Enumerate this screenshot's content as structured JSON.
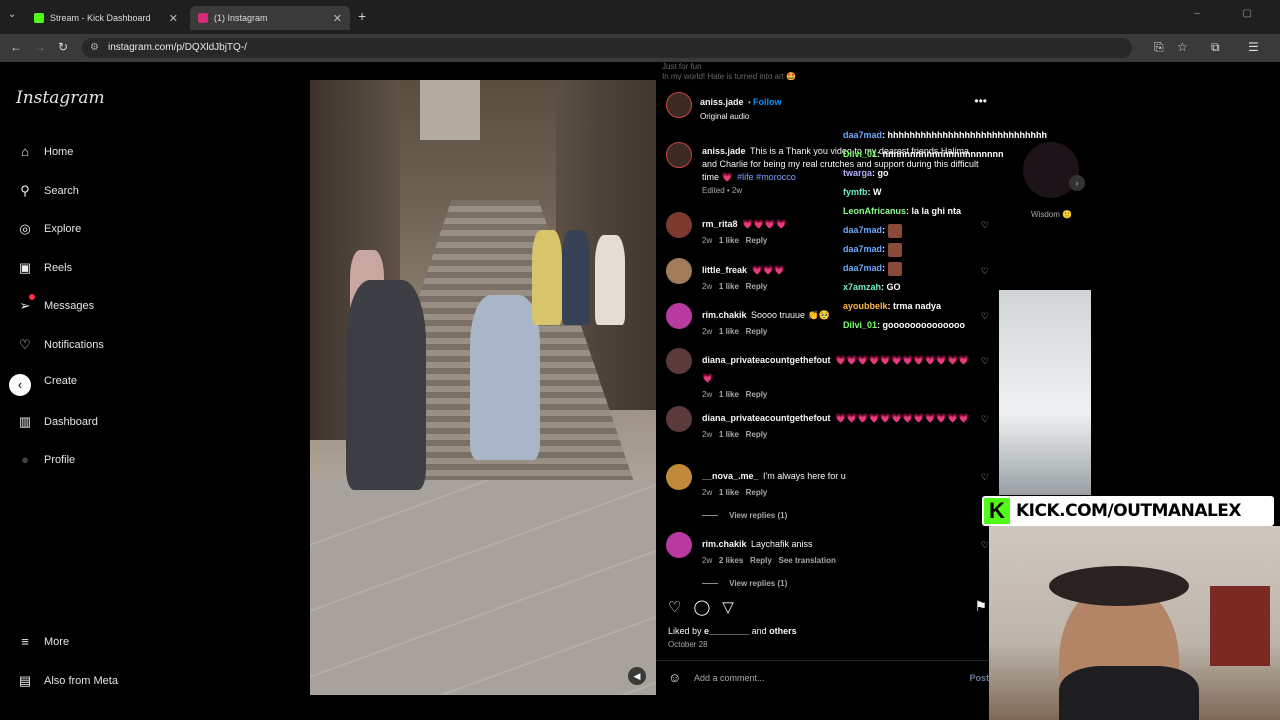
{
  "browser": {
    "tabs": [
      {
        "title": "Stream - Kick Dashboard",
        "favicon_color": "#53fc18"
      },
      {
        "title": "(1) Instagram",
        "favicon_color": "#d62976"
      }
    ],
    "url": "instagram.com/p/DQXldJbjTQ-/"
  },
  "sidebar": {
    "logo": "Instagram",
    "items": [
      {
        "label": "Home",
        "icon": "home-icon",
        "glyph": "⌂"
      },
      {
        "label": "Search",
        "icon": "search-icon",
        "glyph": "⚲"
      },
      {
        "label": "Explore",
        "icon": "compass-icon",
        "glyph": "◎"
      },
      {
        "label": "Reels",
        "icon": "reels-icon",
        "glyph": "▣"
      },
      {
        "label": "Messages",
        "icon": "messages-icon",
        "glyph": "➢"
      },
      {
        "label": "Notifications",
        "icon": "heart-icon",
        "glyph": "♡"
      },
      {
        "label": "Create",
        "icon": "create-icon",
        "glyph": "‹"
      },
      {
        "label": "Dashboard",
        "icon": "dashboard-icon",
        "glyph": "▥"
      },
      {
        "label": "Profile",
        "icon": "profile-icon",
        "glyph": "●"
      }
    ],
    "more": "More",
    "also_from_meta": "Also from Meta"
  },
  "post": {
    "author": "aniss.jade",
    "follow": "Follow",
    "audio": "Original audio",
    "caption_user": "aniss.jade",
    "caption": "This is a Thank you video to my dearest friends Halima and Charlie for being my real crutches and support during this difficult time 💗",
    "tags": "#life #morocco",
    "caption_meta": "Edited • 2w",
    "likes_text": "Liked by",
    "likes_user": "e________",
    "likes_others": "others",
    "likes_and": "and",
    "date": "October 28",
    "add_comment": "Add a comment...",
    "post_button": "Post",
    "top_overlay_1": "Just for fun",
    "top_overlay_2": "In my world! Hate is turned into art 🤩"
  },
  "comments": [
    {
      "user": "rm_rita8",
      "text": "💗💗💗💗",
      "age": "2w",
      "likes": "1 like",
      "reply": "Reply",
      "color": "#7a3b2e"
    },
    {
      "user": "little_freak",
      "text": "💗💗💗",
      "age": "2w",
      "likes": "1 like",
      "reply": "Reply",
      "color": "#a07c5a"
    },
    {
      "user": "rim.chakik",
      "text": "Soooo truuue 👏🥺",
      "age": "2w",
      "likes": "1 like",
      "reply": "Reply",
      "color": "#b83aa0"
    },
    {
      "user": "diana_privateacountgethefout",
      "text": "💗💗💗💗💗💗💗💗💗💗💗💗💗",
      "age": "2w",
      "likes": "1 like",
      "reply": "Reply",
      "color": "#5a3a3a"
    },
    {
      "user": "diana_privateacountgethefout",
      "text": "💗💗💗💗💗💗💗💗💗💗💗💗",
      "age": "2w",
      "likes": "1 like",
      "reply": "Reply",
      "color": "#5a3a3a"
    },
    {
      "user": "__nova_.me_",
      "text": "I'm always here for u",
      "age": "2w",
      "likes": "1 like",
      "reply": "Reply",
      "color": "#c08a3a",
      "view_replies": "View replies (1)"
    },
    {
      "user": "rim.chakik",
      "text": "Laychafik aniss",
      "age": "2w",
      "likes": "2 likes",
      "reply": "Reply",
      "see_translation": "See translation",
      "color": "#b83aa0",
      "view_replies": "View replies (1)"
    }
  ],
  "stream_chat": [
    {
      "user": "daa7mad",
      "msg": ": hhhhhhhhhhhhhhhhhhhhhhhhhhhhh",
      "color": "#6fa8ff"
    },
    {
      "user": "Dilvi_01",
      "msg": ": nnnnnnnnnnnnnnnnnnnnnn",
      "color": "#7dff6a"
    },
    {
      "user": "twarga",
      "msg": ": go",
      "color": "#b0b0ff"
    },
    {
      "user": "fymfb",
      "msg": ": W",
      "color": "#6ff0c0"
    },
    {
      "user": "LeonAfricanus",
      "msg": ": la la ghi nta",
      "color": "#8cff8c"
    },
    {
      "user": "daa7mad",
      "msg": ":",
      "color": "#6fa8ff",
      "chip": true
    },
    {
      "user": "daa7mad",
      "msg": ":",
      "color": "#6fa8ff",
      "chip": true
    },
    {
      "user": "daa7mad",
      "msg": ":",
      "color": "#6fa8ff",
      "chip": true
    },
    {
      "user": "x7amzah",
      "msg": ": GO",
      "color": "#6ff0c0"
    },
    {
      "user": "ayoubbelk",
      "msg": ": trma nadya",
      "color": "#ffb84d"
    },
    {
      "user": "Dilvi_01",
      "msg": ": goooooooooooooo",
      "color": "#7dff6a"
    }
  ],
  "side_story_label": "Wisdom 🙂",
  "kick_banner": "KICK.COM/OUTMANALEX"
}
